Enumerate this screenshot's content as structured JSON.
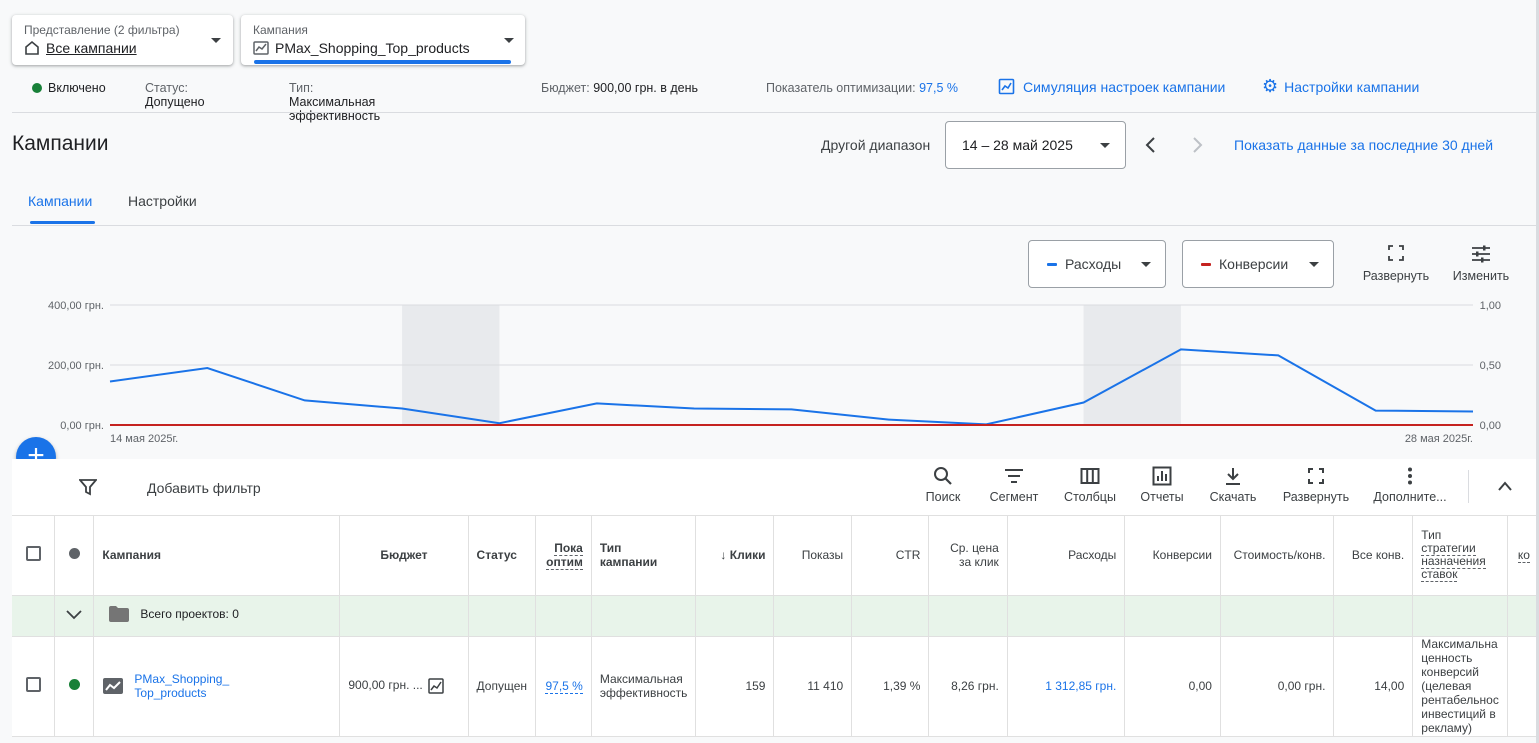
{
  "view_selector": {
    "label": "Представление (2 фильтра)",
    "value": "Все кампании"
  },
  "campaign_selector": {
    "label": "Кампания",
    "value": "PMax_Shopping_Top_products"
  },
  "status_bar": {
    "enabled": "Включено",
    "status_label": "Статус:",
    "status_value": "Допущено",
    "type_label": "Тип:",
    "type_value": "Максимальная эффективность",
    "budget_label": "Бюджет:",
    "budget_value": "900,00 грн. в день",
    "opt_label": "Показатель оптимизации:",
    "opt_value": "97,5 %",
    "simulation": "Симуляция настроек кампании",
    "settings": "Настройки кампании"
  },
  "page_title": "Кампании",
  "date_range": {
    "label": "Другой диапазон",
    "value": "14 – 28 май 2025",
    "last30": "Показать данные за последние 30 дней"
  },
  "tabs": [
    {
      "label": "Кампании"
    },
    {
      "label": "Настройки"
    }
  ],
  "metrics": {
    "m1": "Расходы",
    "m2": "Конверсии",
    "expand": "Развернуть",
    "edit": "Изменить"
  },
  "colors": {
    "spend": "#1a73e8",
    "conversions": "#c5221f",
    "accent": "#1a73e8",
    "enabled": "#188038"
  },
  "chart_data": {
    "type": "line",
    "x": [
      "2025-05-14",
      "2025-05-15",
      "2025-05-16",
      "2025-05-17",
      "2025-05-18",
      "2025-05-19",
      "2025-05-20",
      "2025-05-21",
      "2025-05-22",
      "2025-05-23",
      "2025-05-24",
      "2025-05-25",
      "2025-05-26",
      "2025-05-27",
      "2025-05-28"
    ],
    "series": [
      {
        "name": "Расходы",
        "axis": "left",
        "values": [
          145,
          190,
          82,
          55,
          6,
          72,
          55,
          52,
          18,
          2,
          75,
          252,
          232,
          48,
          45
        ]
      },
      {
        "name": "Конверсии",
        "axis": "right",
        "values": [
          0,
          0,
          0,
          0,
          0,
          0,
          0,
          0,
          0,
          0,
          0,
          0,
          0,
          0,
          0
        ]
      }
    ],
    "y_left": {
      "ticks": [
        "400,00 грн.",
        "200,00 грн.",
        "0,00 грн."
      ],
      "range": [
        0,
        400
      ]
    },
    "y_right": {
      "ticks": [
        "1,00",
        "0,50",
        "0,00"
      ],
      "range": [
        0,
        1
      ]
    },
    "x_start_label": "14 мая 2025г.",
    "x_end_label": "28 мая 2025г.",
    "weekend_shading": [
      [
        3,
        4
      ],
      [
        10,
        11
      ]
    ],
    "grid": true
  },
  "toolbar": {
    "add_filter": "Добавить фильтр",
    "search": "Поиск",
    "segment": "Сегмент",
    "columns": "Столбцы",
    "reports": "Отчеты",
    "download": "Скачать",
    "expand": "Развернуть",
    "more": "Дополните..."
  },
  "table": {
    "headers": {
      "campaign": "Кампания",
      "budget": "Бюджет",
      "status": "Статус",
      "opt_1": "Пока",
      "opt_2": "оптим",
      "type_1": "Тип",
      "type_2": "кампании",
      "clicks": "Клики",
      "impr": "Показы",
      "ctr": "CTR",
      "cpc_1": "Ср. цена",
      "cpc_2": "за клик",
      "cost": "Расходы",
      "conv": "Конверсии",
      "cpa": "Стоимость/конв.",
      "allconv": "Все конв.",
      "bid_1": "Тип",
      "bid_2": "стратегии",
      "bid_3": "назначения",
      "bid_4": "ставок",
      "extra": "ко"
    },
    "total_label": "Всего проектов: 0",
    "row": {
      "campaign_1": "PMax_Shopping_",
      "campaign_2": "Top_products",
      "budget": "900,00 грн. ...",
      "status": "Допущен",
      "opt": "97,5 %",
      "type_1": "Максимальная",
      "type_2": "эффективность",
      "clicks": "159",
      "impr": "11 410",
      "ctr": "1,39 %",
      "cpc": "8,26 грн.",
      "cost": "1 312,85 грн.",
      "conv": "0,00",
      "cpa": "0,00 грн.",
      "allconv": "14,00",
      "bid_1": "Максимальна",
      "bid_2": "ценность",
      "bid_3": "конверсий",
      "bid_4": "(целевая",
      "bid_5": "рентабельнос",
      "bid_6": "инвестиций в",
      "bid_7": "рекламу)"
    }
  }
}
